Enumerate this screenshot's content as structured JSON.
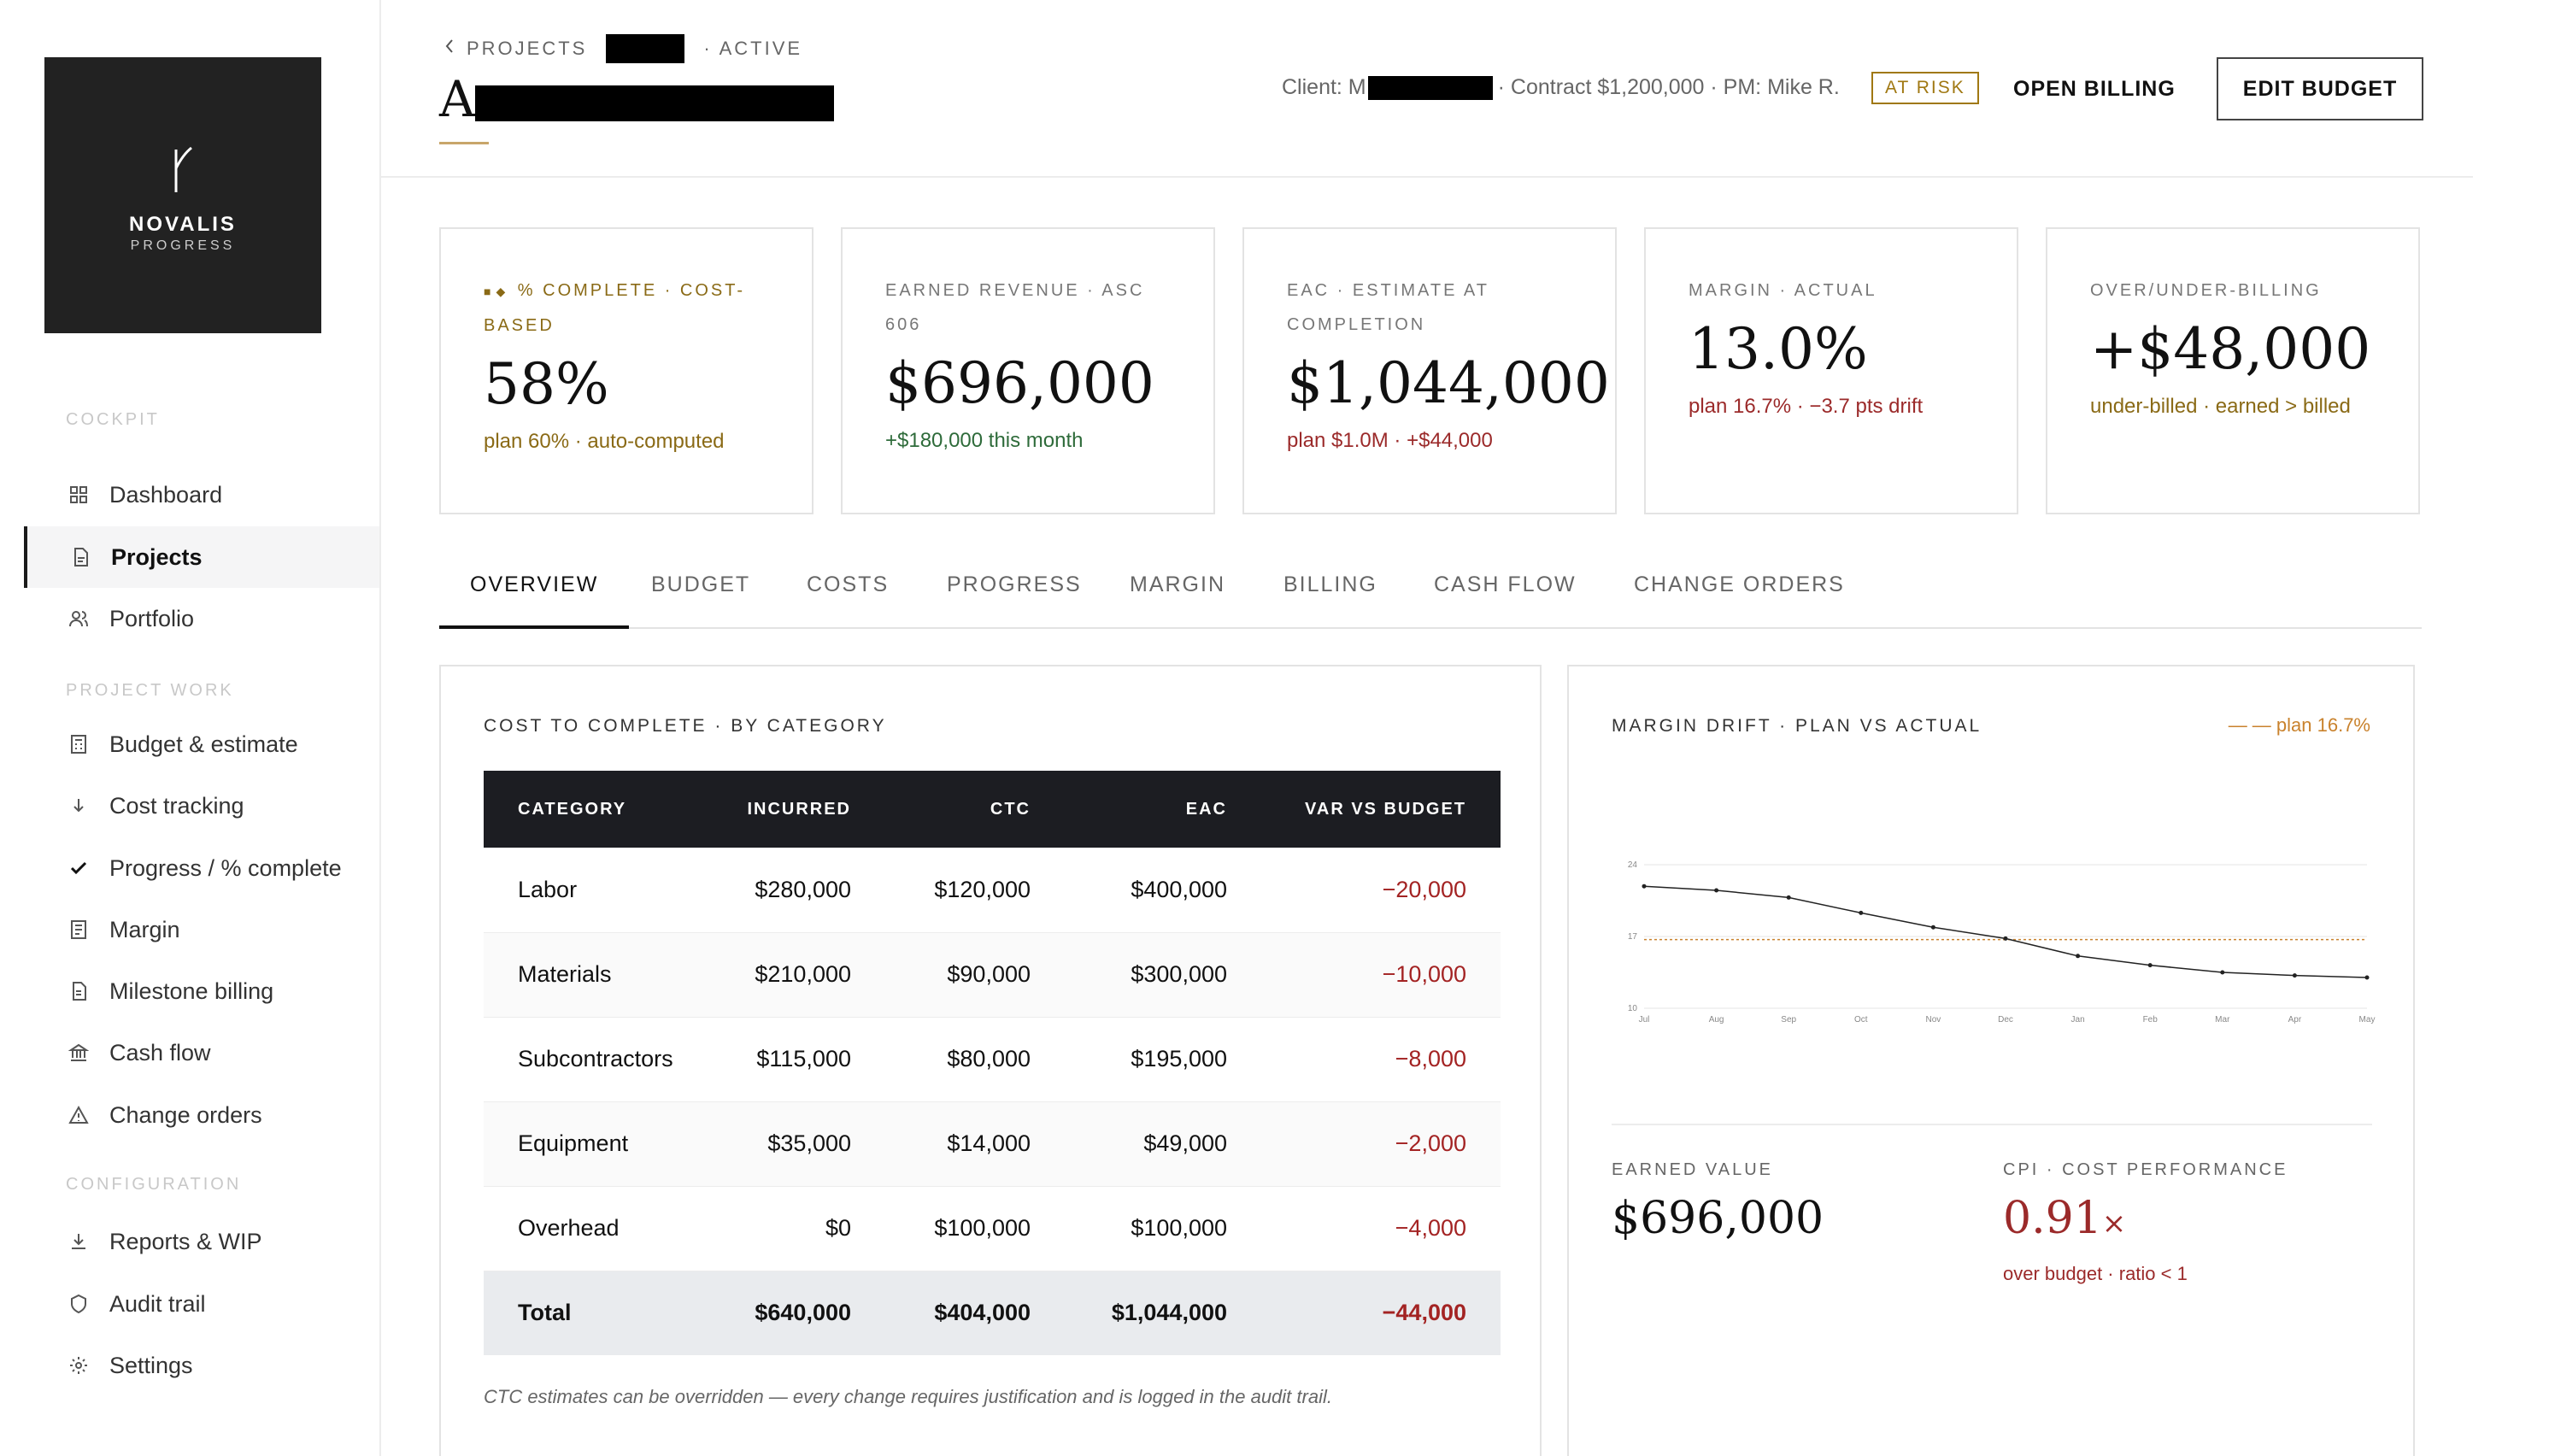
{
  "sidebar": {
    "brand": "NOVALIS",
    "brand_sub": "PROGRESS",
    "sections": [
      {
        "label": "COCKPIT"
      },
      {
        "label": "PROJECT WORK"
      },
      {
        "label": "CONFIGURATION"
      }
    ],
    "items": [
      {
        "label": "Dashboard",
        "icon": "grid-icon"
      },
      {
        "label": "Projects",
        "icon": "document-icon",
        "active": true
      },
      {
        "label": "Portfolio",
        "icon": "users-icon"
      },
      {
        "label": "Budget & estimate",
        "icon": "calculator-icon"
      },
      {
        "label": "Cost tracking",
        "icon": "arrow-down-icon"
      },
      {
        "label": "Progress / % complete",
        "icon": "check-icon"
      },
      {
        "label": "Margin",
        "icon": "ledger-icon"
      },
      {
        "label": "Milestone billing",
        "icon": "invoice-icon"
      },
      {
        "label": "Cash flow",
        "icon": "bank-icon"
      },
      {
        "label": "Change orders",
        "icon": "warning-icon"
      },
      {
        "label": "Reports & WIP",
        "icon": "download-icon"
      },
      {
        "label": "Audit trail",
        "icon": "shield-icon"
      },
      {
        "label": "Settings",
        "icon": "gear-icon"
      }
    ]
  },
  "header": {
    "breadcrumb_root": "PROJECTS",
    "breadcrumb_status": "· ACTIVE",
    "title_initial": "A",
    "client_prefix": "Client: M",
    "meta_rest": "· Contract $1,200,000 · PM: Mike R.",
    "status_badge": "AT RISK",
    "open_billing": "OPEN BILLING",
    "edit_budget": "EDIT BUDGET"
  },
  "kpis": [
    {
      "label": "% COMPLETE · COST-BASED",
      "value": "58%",
      "note": "plan 60% · auto-computed",
      "note_color": "#8a6a16"
    },
    {
      "label": "EARNED REVENUE · ASC 606",
      "value": "$696,000",
      "note": "+$180,000 this month",
      "note_color": "#2e6b3a"
    },
    {
      "label": "EAC · ESTIMATE AT COMPLETION",
      "value": "$1,044,000",
      "note": "plan $1.0M · +$44,000",
      "note_color": "#9b2a2a"
    },
    {
      "label": "MARGIN · ACTUAL",
      "value": "13.0%",
      "note": "plan 16.7% · −3.7 pts drift",
      "note_color": "#9b2a2a"
    },
    {
      "label": "OVER/UNDER-BILLING",
      "value": "+$48,000",
      "note": "under-billed · earned > billed",
      "note_color": "#8a6a16"
    }
  ],
  "tabs": [
    "OVERVIEW",
    "BUDGET",
    "COSTS",
    "PROGRESS",
    "MARGIN",
    "BILLING",
    "CASH FLOW",
    "CHANGE ORDERS"
  ],
  "ctc": {
    "title": "COST TO COMPLETE · BY CATEGORY",
    "columns": [
      "CATEGORY",
      "INCURRED",
      "CTC",
      "EAC",
      "VAR VS BUDGET"
    ],
    "rows": [
      [
        "Labor",
        "$280,000",
        "$120,000",
        "$400,000",
        "−20,000"
      ],
      [
        "Materials",
        "$210,000",
        "$90,000",
        "$300,000",
        "−10,000"
      ],
      [
        "Subcontractors",
        "$115,000",
        "$80,000",
        "$195,000",
        "−8,000"
      ],
      [
        "Equipment",
        "$35,000",
        "$14,000",
        "$49,000",
        "−2,000"
      ],
      [
        "Overhead",
        "$0",
        "$100,000",
        "$100,000",
        "−4,000"
      ]
    ],
    "total": [
      "Total",
      "$640,000",
      "$404,000",
      "$1,044,000",
      "−44,000"
    ],
    "footnote": "CTC estimates can be overridden — every change requires justification and is logged in the audit trail."
  },
  "margin_panel": {
    "title": "MARGIN DRIFT · PLAN VS ACTUAL",
    "legend": "— — plan 16.7%",
    "earned_label": "EARNED VALUE",
    "earned_value": "$696,000",
    "cpi_label": "CPI · COST PERFORMANCE",
    "cpi_value": "0.91",
    "cpi_unit": "×",
    "cpi_note": "over budget · ratio < 1"
  },
  "chart_data": {
    "type": "line",
    "x": [
      "Jul",
      "Aug",
      "Sep",
      "Oct",
      "Nov",
      "Dec",
      "Jan",
      "Feb",
      "Mar",
      "Apr",
      "May"
    ],
    "series": [
      {
        "values": [
          21.9,
          21.5,
          20.8,
          19.3,
          17.9,
          16.8,
          15.1,
          14.2,
          13.5,
          13.2,
          13.0
        ]
      }
    ],
    "plan_line": 16.7,
    "yticks": [
      10,
      17,
      24
    ],
    "ylim": [
      10,
      24
    ],
    "grid": true,
    "colors": {
      "actual": "#222222",
      "plan": "#c9822d"
    }
  }
}
